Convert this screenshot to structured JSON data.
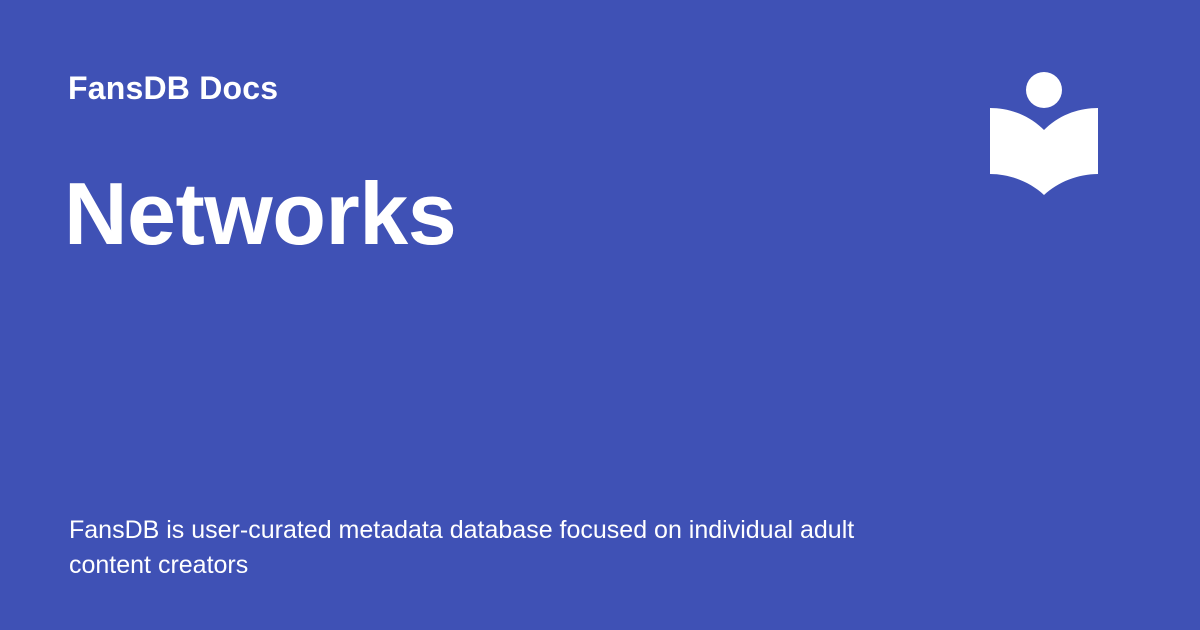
{
  "header": {
    "site_name": "FansDB Docs"
  },
  "page": {
    "title": "Networks",
    "description": "FansDB is user-curated metadata database focused on individual adult content creators"
  },
  "logo": {
    "icon": "reading-book-icon"
  },
  "colors": {
    "background": "#3f51b5",
    "foreground": "#ffffff"
  }
}
